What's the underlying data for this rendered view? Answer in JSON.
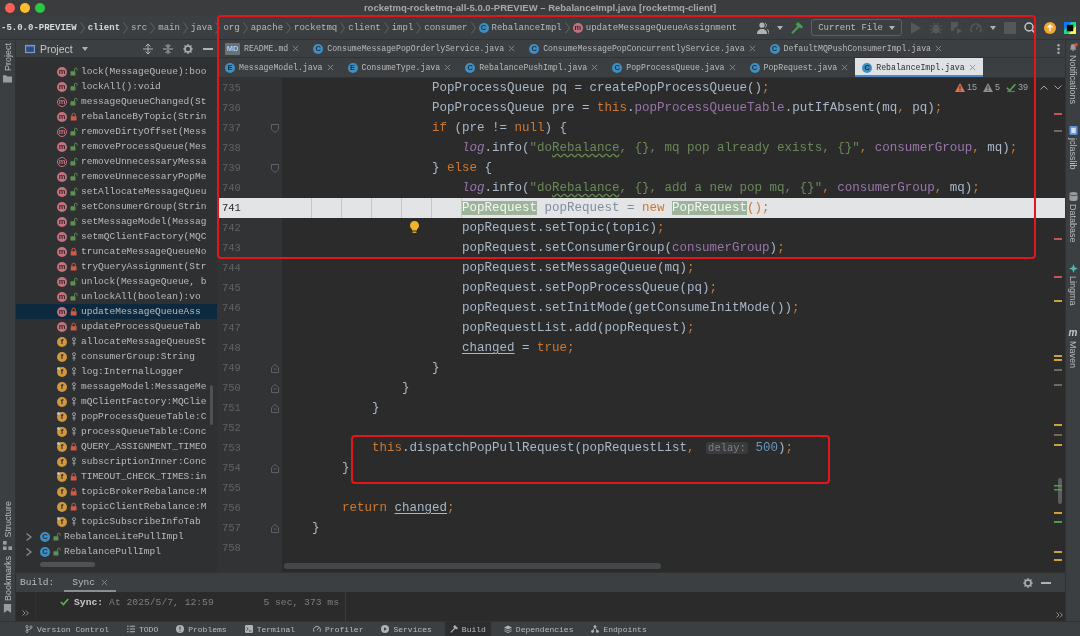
{
  "window": {
    "title": "rocketmq-rocketmq-all-5.0.0-PREVIEW – RebalanceImpl.java [rocketmq-client]"
  },
  "navigation_bar": {
    "breadcrumbs": [
      {
        "kind": "module",
        "text": "-5.0.0-PREVIEW"
      },
      {
        "kind": "module",
        "text": "client"
      },
      {
        "kind": "dir",
        "text": "src"
      },
      {
        "kind": "dir",
        "text": "main"
      },
      {
        "kind": "dir",
        "text": "java"
      },
      {
        "kind": "dir",
        "text": "org"
      },
      {
        "kind": "dir",
        "text": "apache"
      },
      {
        "kind": "dir",
        "text": "rocketmq"
      },
      {
        "kind": "dir",
        "text": "client"
      },
      {
        "kind": "dir",
        "text": "impl"
      },
      {
        "kind": "dir",
        "text": "consumer"
      },
      {
        "kind": "class",
        "badge": "C",
        "text": "RebalanceImpl"
      },
      {
        "kind": "method",
        "badge": "m",
        "text": "updateMessageQueueAssignment"
      }
    ],
    "run_config": "Current File"
  },
  "left_tool_strip": {
    "top": [
      {
        "kind": "project",
        "label": "Project"
      }
    ],
    "bottom": [
      {
        "kind": "structure",
        "label": "Structure"
      },
      {
        "kind": "bookmarks",
        "label": "Bookmarks"
      }
    ]
  },
  "project_panel": {
    "title": "Project",
    "members": [
      {
        "kind": "method-public",
        "badge": "m",
        "abstract": false,
        "label": "lock(MessageQueue):boo",
        "selected": false
      },
      {
        "kind": "method-public",
        "badge": "m",
        "abstract": false,
        "label": "lockAll():void",
        "selected": false
      },
      {
        "kind": "method-public",
        "badge": "m",
        "abstract": true,
        "label": "messageQueueChanged(St",
        "selected": false
      },
      {
        "kind": "method-private",
        "badge": "m",
        "abstract": false,
        "label": "rebalanceByTopic(Strin",
        "selected": false
      },
      {
        "kind": "method-public",
        "badge": "m",
        "abstract": true,
        "label": "removeDirtyOffset(Mess",
        "selected": false
      },
      {
        "kind": "method-public",
        "badge": "m",
        "abstract": false,
        "label": "removeProcessQueue(Mes",
        "selected": false
      },
      {
        "kind": "method-public",
        "badge": "m",
        "abstract": true,
        "label": "removeUnnecessaryMessa",
        "selected": false
      },
      {
        "kind": "method-public",
        "badge": "m",
        "abstract": false,
        "label": "removeUnnecessaryPopMe",
        "selected": false
      },
      {
        "kind": "method-public",
        "badge": "m",
        "abstract": false,
        "label": "setAllocateMessageQueu",
        "selected": false
      },
      {
        "kind": "method-public",
        "badge": "m",
        "abstract": false,
        "label": "setConsumerGroup(Strin",
        "selected": false
      },
      {
        "kind": "method-public",
        "badge": "m",
        "abstract": false,
        "label": "setMessageModel(Messag",
        "selected": false
      },
      {
        "kind": "method-public",
        "badge": "m",
        "abstract": false,
        "label": "setmQClientFactory(MQC",
        "selected": false
      },
      {
        "kind": "method-private",
        "badge": "m",
        "abstract": false,
        "label": "truncateMessageQueueNo",
        "selected": false
      },
      {
        "kind": "method-private",
        "badge": "m",
        "abstract": false,
        "label": "tryQueryAssignment(Str",
        "selected": false
      },
      {
        "kind": "method-public",
        "badge": "m",
        "abstract": false,
        "label": "unlock(MessageQueue, b",
        "selected": false
      },
      {
        "kind": "method-public",
        "badge": "m",
        "abstract": false,
        "label": "unlockAll(boolean):vo",
        "selected": false
      },
      {
        "kind": "method-private",
        "badge": "m",
        "abstract": false,
        "label": "updateMessageQueueAss",
        "selected": true
      },
      {
        "kind": "method-private",
        "badge": "m",
        "abstract": false,
        "label": "updateProcessQueueTab",
        "selected": false
      },
      {
        "kind": "field-package",
        "badge": "f",
        "final": false,
        "label": "allocateMessageQueueSt",
        "selected": false
      },
      {
        "kind": "field-package",
        "badge": "f",
        "final": false,
        "label": "consumerGroup:String",
        "selected": false
      },
      {
        "kind": "field-package",
        "badge": "f",
        "final": true,
        "label": "log:InternalLogger",
        "selected": false
      },
      {
        "kind": "field-package",
        "badge": "f",
        "final": false,
        "label": "messageModel:MessageMe",
        "selected": false
      },
      {
        "kind": "field-package",
        "badge": "f",
        "final": false,
        "label": "mQClientFactory:MQClie",
        "selected": false
      },
      {
        "kind": "field-package",
        "badge": "f",
        "final": true,
        "label": "popProcessQueueTable:C",
        "selected": false
      },
      {
        "kind": "field-package",
        "badge": "f",
        "final": true,
        "label": "processQueueTable:Conc",
        "selected": false
      },
      {
        "kind": "field-private",
        "badge": "f",
        "final": true,
        "label": "QUERY_ASSIGNMENT_TIMEO",
        "selected": false
      },
      {
        "kind": "field-package",
        "badge": "f",
        "final": false,
        "label": "subscriptionInner:Conc",
        "selected": false
      },
      {
        "kind": "field-private",
        "badge": "f",
        "final": true,
        "label": "TIMEOUT_CHECK_TIMES:in",
        "selected": false
      },
      {
        "kind": "field-private",
        "badge": "f",
        "final": false,
        "label": "topicBrokerRebalance:M",
        "selected": false
      },
      {
        "kind": "field-private",
        "badge": "f",
        "final": false,
        "label": "topicClientRebalance:M",
        "selected": false
      },
      {
        "kind": "field-package",
        "badge": "f",
        "final": true,
        "label": "topicSubscribeInfoTab",
        "selected": false
      }
    ],
    "classes": [
      {
        "kind": "class-public",
        "badge": "C",
        "expanded": false,
        "label": "RebalanceLitePullImpl",
        "selected": false
      },
      {
        "kind": "class-public",
        "badge": "C",
        "expanded": false,
        "label": "RebalancePullImpl",
        "selected": false
      }
    ]
  },
  "editor": {
    "annotation_frame": true,
    "tab_rows": [
      {
        "tabs": [
          {
            "kind": "markdown",
            "badge": "MD",
            "label": "README.md",
            "selected": false
          },
          {
            "kind": "class",
            "badge": "C",
            "label": "ConsumeMessagePopOrderlyService.java",
            "selected": false
          },
          {
            "kind": "class",
            "badge": "C",
            "label": "ConsumeMessagePopConcurrentlyService.java",
            "selected": false
          },
          {
            "kind": "class",
            "badge": "C",
            "label": "DefaultMQPushConsumerImpl.java",
            "selected": false
          }
        ]
      },
      {
        "tabs": [
          {
            "kind": "enum",
            "badge": "E",
            "label": "MessageModel.java",
            "selected": false
          },
          {
            "kind": "enum",
            "badge": "E",
            "label": "ConsumeType.java",
            "selected": false
          },
          {
            "kind": "class",
            "badge": "C",
            "label": "RebalancePushImpl.java",
            "selected": false
          },
          {
            "kind": "class",
            "badge": "C",
            "label": "PopProcessQueue.java",
            "selected": false
          },
          {
            "kind": "class",
            "badge": "C",
            "label": "PopRequest.java",
            "selected": false
          },
          {
            "kind": "class",
            "badge": "C",
            "label": "RebalanceImpl.java",
            "selected": true
          }
        ]
      }
    ],
    "inspections": [
      {
        "kind": "warning",
        "count": "15"
      },
      {
        "kind": "weak-warning",
        "count": "5"
      },
      {
        "kind": "typo",
        "count": "39"
      }
    ],
    "code_lines": [
      {
        "number": "735",
        "kind": "code",
        "highlighted": false,
        "bulb": false,
        "framed": false,
        "tokens": [
          {
            "kind": "plain",
            "text": "                    PopProcessQueue pq = createPopProcessQueue()"
          },
          {
            "kind": "punct",
            "text": ";"
          }
        ]
      },
      {
        "number": "736",
        "kind": "code",
        "highlighted": false,
        "bulb": false,
        "framed": false,
        "tokens": [
          {
            "kind": "plain",
            "text": "                    PopProcessQueue pre = "
          },
          {
            "kind": "keyword",
            "text": "this"
          },
          {
            "kind": "plain",
            "text": "."
          },
          {
            "kind": "field",
            "text": "popProcessQueueTable"
          },
          {
            "kind": "plain",
            "text": ".putIfAbsent(mq"
          },
          {
            "kind": "punct",
            "text": ", "
          },
          {
            "kind": "plain",
            "text": "pq)"
          },
          {
            "kind": "punct",
            "text": ";"
          }
        ]
      },
      {
        "number": "737",
        "kind": "fold-start",
        "highlighted": false,
        "bulb": false,
        "framed": false,
        "tokens": [
          {
            "kind": "keyword",
            "text": "                    if"
          },
          {
            "kind": "plain",
            "text": " (pre != "
          },
          {
            "kind": "keyword",
            "text": "null"
          },
          {
            "kind": "plain",
            "text": ") {"
          }
        ]
      },
      {
        "number": "738",
        "kind": "code",
        "highlighted": false,
        "bulb": false,
        "framed": false,
        "tokens": [
          {
            "kind": "static-field",
            "text": "                        log"
          },
          {
            "kind": "plain",
            "text": ".info("
          },
          {
            "kind": "string",
            "text": "\"do"
          },
          {
            "kind": "typo",
            "text": "Rebalance"
          },
          {
            "kind": "string",
            "text": ", {}, mq pop already exists, {}\""
          },
          {
            "kind": "punct",
            "text": ", "
          },
          {
            "kind": "field",
            "text": "consumerGroup"
          },
          {
            "kind": "punct",
            "text": ", "
          },
          {
            "kind": "plain",
            "text": "mq)"
          },
          {
            "kind": "punct",
            "text": ";"
          }
        ]
      },
      {
        "number": "739",
        "kind": "fold-start",
        "highlighted": false,
        "bulb": false,
        "framed": false,
        "tokens": [
          {
            "kind": "plain",
            "text": "                    } "
          },
          {
            "kind": "keyword",
            "text": "else"
          },
          {
            "kind": "plain",
            "text": " {"
          }
        ]
      },
      {
        "number": "740",
        "kind": "code",
        "highlighted": false,
        "bulb": false,
        "framed": false,
        "tokens": [
          {
            "kind": "static-field",
            "text": "                        log"
          },
          {
            "kind": "plain",
            "text": ".info("
          },
          {
            "kind": "string",
            "text": "\"do"
          },
          {
            "kind": "typo",
            "text": "Rebalance"
          },
          {
            "kind": "string",
            "text": ", {}, add a new pop mq, {}\""
          },
          {
            "kind": "punct",
            "text": ", "
          },
          {
            "kind": "field",
            "text": "consumerGroup"
          },
          {
            "kind": "punct",
            "text": ", "
          },
          {
            "kind": "plain",
            "text": "mq)"
          },
          {
            "kind": "punct",
            "text": ";"
          }
        ]
      },
      {
        "number": "741",
        "kind": "code",
        "highlighted": true,
        "bulb": false,
        "framed": false,
        "tokens": [
          {
            "kind": "usage",
            "text": "                        PopRequest"
          },
          {
            "kind": "plain",
            "text": " popRequest = "
          },
          {
            "kind": "keyword",
            "text": "new "
          },
          {
            "kind": "usage",
            "text": "PopRequest"
          },
          {
            "kind": "punct",
            "text": "();"
          }
        ]
      },
      {
        "number": "742",
        "kind": "code",
        "highlighted": false,
        "bulb": true,
        "framed": false,
        "tokens": [
          {
            "kind": "plain",
            "text": "                        popRequest.setTopic(topic)"
          },
          {
            "kind": "punct",
            "text": ";"
          }
        ]
      },
      {
        "number": "743",
        "kind": "code",
        "highlighted": false,
        "bulb": false,
        "framed": false,
        "tokens": [
          {
            "kind": "plain",
            "text": "                        popRequest.setConsumerGroup("
          },
          {
            "kind": "field",
            "text": "consumerGroup"
          },
          {
            "kind": "plain",
            "text": ")"
          },
          {
            "kind": "punct",
            "text": ";"
          }
        ]
      },
      {
        "number": "744",
        "kind": "code",
        "highlighted": false,
        "bulb": false,
        "framed": false,
        "tokens": [
          {
            "kind": "plain",
            "text": "                        popRequest.setMessageQueue(mq)"
          },
          {
            "kind": "punct",
            "text": ";"
          }
        ]
      },
      {
        "number": "745",
        "kind": "code",
        "highlighted": false,
        "bulb": false,
        "framed": false,
        "tokens": [
          {
            "kind": "plain",
            "text": "                        popRequest.setPopProcessQueue(pq)"
          },
          {
            "kind": "punct",
            "text": ";"
          }
        ]
      },
      {
        "number": "746",
        "kind": "code",
        "highlighted": false,
        "bulb": false,
        "framed": false,
        "tokens": [
          {
            "kind": "plain",
            "text": "                        popRequest.setInitMode(getConsumeInitMode())"
          },
          {
            "kind": "punct",
            "text": ";"
          }
        ]
      },
      {
        "number": "747",
        "kind": "code",
        "highlighted": false,
        "bulb": false,
        "framed": false,
        "tokens": [
          {
            "kind": "plain",
            "text": "                        popRequestList.add(popRequest)"
          },
          {
            "kind": "punct",
            "text": ";"
          }
        ]
      },
      {
        "number": "748",
        "kind": "code",
        "highlighted": false,
        "bulb": false,
        "framed": false,
        "tokens": [
          {
            "kind": "reassigned",
            "text": "                        changed"
          },
          {
            "kind": "plain",
            "text": " = "
          },
          {
            "kind": "keyword",
            "text": "true"
          },
          {
            "kind": "punct",
            "text": ";"
          }
        ]
      },
      {
        "number": "749",
        "kind": "fold-end",
        "highlighted": false,
        "bulb": false,
        "framed": false,
        "tokens": [
          {
            "kind": "plain",
            "text": "                    }"
          }
        ]
      },
      {
        "number": "750",
        "kind": "fold-end",
        "highlighted": false,
        "bulb": false,
        "framed": false,
        "tokens": [
          {
            "kind": "plain",
            "text": "                }"
          }
        ]
      },
      {
        "number": "751",
        "kind": "fold-end",
        "highlighted": false,
        "bulb": false,
        "framed": false,
        "tokens": [
          {
            "kind": "plain",
            "text": "            }"
          }
        ]
      },
      {
        "number": "752",
        "kind": "code",
        "highlighted": false,
        "bulb": false,
        "framed": false
      },
      {
        "number": "753",
        "kind": "code",
        "highlighted": false,
        "bulb": false,
        "framed": true,
        "tokens": [
          {
            "kind": "keyword",
            "text": "            this"
          },
          {
            "kind": "plain",
            "text": ".dispatchPopPullRequest(popRequestList"
          },
          {
            "kind": "punct",
            "text": ", "
          },
          {
            "kind": "hint",
            "text": "delay:"
          },
          {
            "kind": "number",
            "text": " 500"
          },
          {
            "kind": "plain",
            "text": ")"
          },
          {
            "kind": "punct",
            "text": ";"
          }
        ]
      },
      {
        "number": "754",
        "kind": "fold-end",
        "highlighted": false,
        "bulb": false,
        "framed": false,
        "tokens": [
          {
            "kind": "plain",
            "text": "        }"
          }
        ]
      },
      {
        "number": "755",
        "kind": "code",
        "highlighted": false,
        "bulb": false,
        "framed": false
      },
      {
        "number": "756",
        "kind": "code",
        "highlighted": false,
        "bulb": false,
        "framed": false,
        "tokens": [
          {
            "kind": "keyword",
            "text": "        return "
          },
          {
            "kind": "reassigned",
            "text": "changed"
          },
          {
            "kind": "punct",
            "text": ";"
          }
        ]
      },
      {
        "number": "757",
        "kind": "fold-end",
        "highlighted": false,
        "bulb": false,
        "framed": false,
        "tokens": [
          {
            "kind": "plain",
            "text": "    }"
          }
        ]
      },
      {
        "number": "758",
        "kind": "code",
        "highlighted": false,
        "bulb": false,
        "framed": false
      }
    ]
  },
  "right_tool_strip": [
    {
      "kind": "notifications",
      "label": "Notifications"
    },
    {
      "kind": "jclasslib",
      "label": "jclasslib"
    },
    {
      "kind": "database",
      "label": "Database"
    },
    {
      "kind": "lingma",
      "label": "Lingma"
    },
    {
      "kind": "maven",
      "badge": "m",
      "label": "Maven"
    }
  ],
  "build_panel": {
    "title": "Build:",
    "tabs": [
      {
        "label": "Sync",
        "selected": true
      }
    ],
    "rows": [
      {
        "kind": "success",
        "title": "Sync:",
        "detail": "At 2025/5/7, 12:59",
        "duration": "5 sec, 373 ms"
      }
    ]
  },
  "status_bar": [
    {
      "kind": "vcs",
      "label": "Version Control",
      "selected": false
    },
    {
      "kind": "todo",
      "label": "TODO",
      "selected": false
    },
    {
      "kind": "problems",
      "label": "Problems",
      "selected": false
    },
    {
      "kind": "terminal",
      "label": "Terminal",
      "selected": false
    },
    {
      "kind": "profiler",
      "label": "Profiler",
      "selected": false
    },
    {
      "kind": "services",
      "label": "Services",
      "selected": false
    },
    {
      "kind": "build",
      "label": "Build",
      "selected": true
    },
    {
      "kind": "dependencies",
      "label": "Dependencies",
      "selected": false
    },
    {
      "kind": "endpoints",
      "label": "Endpoints",
      "selected": false
    }
  ]
}
